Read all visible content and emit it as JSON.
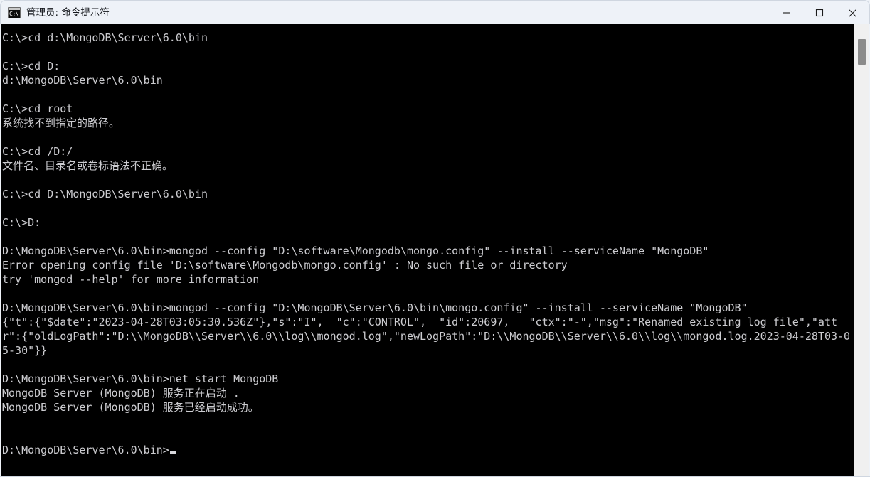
{
  "window": {
    "title": "管理员: 命令提示符",
    "icon": "cmd-icon",
    "icon_glyph": "C:\\",
    "background": "#000000",
    "foreground": "#ccccd0",
    "titlebar_background": "#eef2f8",
    "controls": {
      "minimize_label": "最小化",
      "maximize_label": "最大化",
      "close_label": "关闭"
    }
  },
  "scrollbar": {
    "thumb_color": "#8c8c8c",
    "track_color": "#f0f0f0"
  },
  "console": {
    "cursor_visible": true,
    "lines": [
      "C:\\>cd d:\\MongoDB\\Server\\6.0\\bin",
      "",
      "C:\\>cd D:",
      "d:\\MongoDB\\Server\\6.0\\bin",
      "",
      "C:\\>cd root",
      "系统找不到指定的路径。",
      "",
      "C:\\>cd /D:/",
      "文件名、目录名或卷标语法不正确。",
      "",
      "C:\\>cd D:\\MongoDB\\Server\\6.0\\bin",
      "",
      "C:\\>D:",
      "",
      "D:\\MongoDB\\Server\\6.0\\bin>mongod --config \"D:\\software\\Mongodb\\mongo.config\" --install --serviceName \"MongoDB\"",
      "Error opening config file 'D:\\software\\Mongodb\\mongo.config' : No such file or directory",
      "try 'mongod --help' for more information",
      "",
      "D:\\MongoDB\\Server\\6.0\\bin>mongod --config \"D:\\MongoDB\\Server\\6.0\\bin\\mongo.config\" --install --serviceName \"MongoDB\"",
      "{\"t\":{\"$date\":\"2023-04-28T03:05:30.536Z\"},\"s\":\"I\",  \"c\":\"CONTROL\",  \"id\":20697,   \"ctx\":\"-\",\"msg\":\"Renamed existing log file\",\"attr\":{\"oldLogPath\":\"D:\\\\MongoDB\\\\Server\\\\6.0\\\\log\\\\mongod.log\",\"newLogPath\":\"D:\\\\MongoDB\\\\Server\\\\6.0\\\\log\\\\mongod.log.2023-04-28T03-05-30\"}}",
      "",
      "D:\\MongoDB\\Server\\6.0\\bin>net start MongoDB",
      "MongoDB Server (MongoDB) 服务正在启动 .",
      "MongoDB Server (MongoDB) 服务已经启动成功。",
      "",
      ""
    ],
    "prompt_line": "D:\\MongoDB\\Server\\6.0\\bin>"
  }
}
